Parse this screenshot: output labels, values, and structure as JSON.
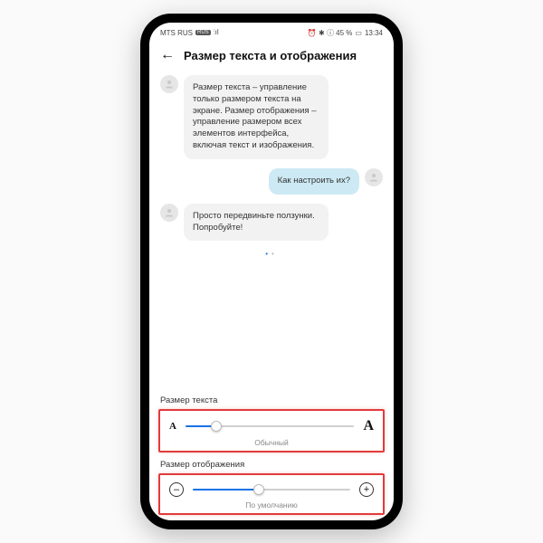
{
  "statusbar": {
    "carrier": "MTS RUS",
    "carrier_badge": "RUS",
    "signal_icon": "⫶ıl",
    "wifi_icon": "⎋",
    "icons_right": "⏰ ✱ ⓘ 45 %",
    "battery": "▭",
    "time": "13:34"
  },
  "header": {
    "back": "←",
    "title": "Размер текста и отображения"
  },
  "chat": {
    "msg1": "Размер текста – управление только размером текста на экране. Размер отображения – управление размером всех элементов интерфейса, включая текст и изображения.",
    "msg2": "Как настроить их?",
    "msg3": "Просто передвиньте ползунки. Попробуйте!"
  },
  "sections": {
    "text_size": {
      "label": "Размер текста",
      "small_A": "A",
      "big_A": "A",
      "caption": "Обычный",
      "fill_pct": 18,
      "thumb_pct": 18
    },
    "display_size": {
      "label": "Размер отображения",
      "minus": "–",
      "plus": "+",
      "caption": "По умолчанию",
      "fill_pct": 42,
      "thumb_pct": 42
    }
  }
}
